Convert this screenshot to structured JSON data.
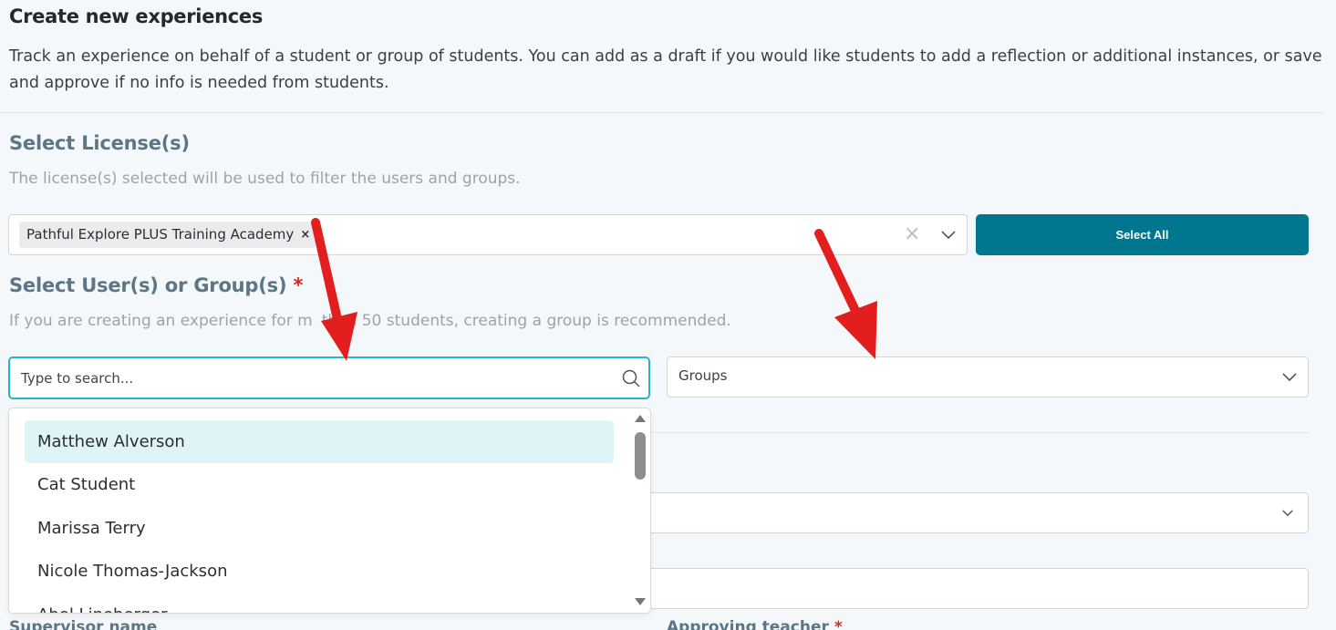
{
  "header": {
    "title": "Create new experiences",
    "description": "Track an experience on behalf of a student or group of students. You can add as a draft if you would like students to add a reflection or additional instances, or save and approve if no info is needed from students."
  },
  "license_section": {
    "title": "Select License(s)",
    "subtitle": "The license(s) selected will be used to filter the users and groups.",
    "selected_chip": "Pathful Explore PLUS Training Academy",
    "chip_remove": "×",
    "clear_symbol": "×",
    "select_all_label": "Select All"
  },
  "users_section": {
    "title": "Select User(s) or Group(s)",
    "required_mark": "*",
    "subtitle_before": "If you are creating an experience for m",
    "subtitle_after": "than 50 students, creating a group is recommended.",
    "search_placeholder": "Type to search...",
    "groups_placeholder": "Groups",
    "results": [
      "Matthew Alverson",
      "Cat Student",
      "Marissa Terry",
      "Nicole Thomas-Jackson",
      "Abel Lineberger"
    ]
  },
  "bottom_labels": {
    "supervisor": "Supervisor name",
    "approving_teacher": "Approving teacher",
    "required_mark": "*"
  },
  "colors": {
    "accent": "#00768f",
    "focus_border": "#27b6c9",
    "highlight": "#dff4f7",
    "section_title": "#5d7685",
    "required": "#e0231b",
    "annotation_arrow": "#e31e1e"
  },
  "icons": [
    "chevron-down-icon",
    "search-icon",
    "close-icon",
    "scroll-up-icon",
    "scroll-down-icon",
    "arrow-annotation-icon"
  ]
}
